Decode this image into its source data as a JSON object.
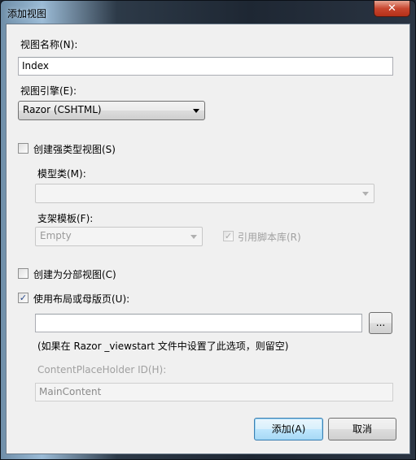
{
  "window": {
    "title": "添加视图",
    "close_label": "✕"
  },
  "view_name": {
    "label": "视图名称(N):",
    "value": "Index"
  },
  "view_engine": {
    "label": "视图引擎(E):",
    "selected": "Razor (CSHTML)"
  },
  "strongly_typed": {
    "label": "创建强类型视图(S)",
    "checked": false
  },
  "model_class": {
    "label": "模型类(M):",
    "value": ""
  },
  "scaffold_template": {
    "label": "支架模板(F):",
    "selected": "Empty"
  },
  "reference_scripts": {
    "label": "引用脚本库(R)",
    "checked": true,
    "enabled": false
  },
  "partial_view": {
    "label": "创建为分部视图(C)",
    "checked": false
  },
  "use_layout": {
    "label": "使用布局或母版页(U):",
    "checked": true,
    "value": "",
    "browse_label": "...",
    "hint": "(如果在 Razor _viewstart 文件中设置了此选项，则留空)"
  },
  "content_placeholder": {
    "label": "ContentPlaceHolder ID(H):",
    "value": "MainContent"
  },
  "buttons": {
    "add": "添加(A)",
    "cancel": "取消"
  }
}
